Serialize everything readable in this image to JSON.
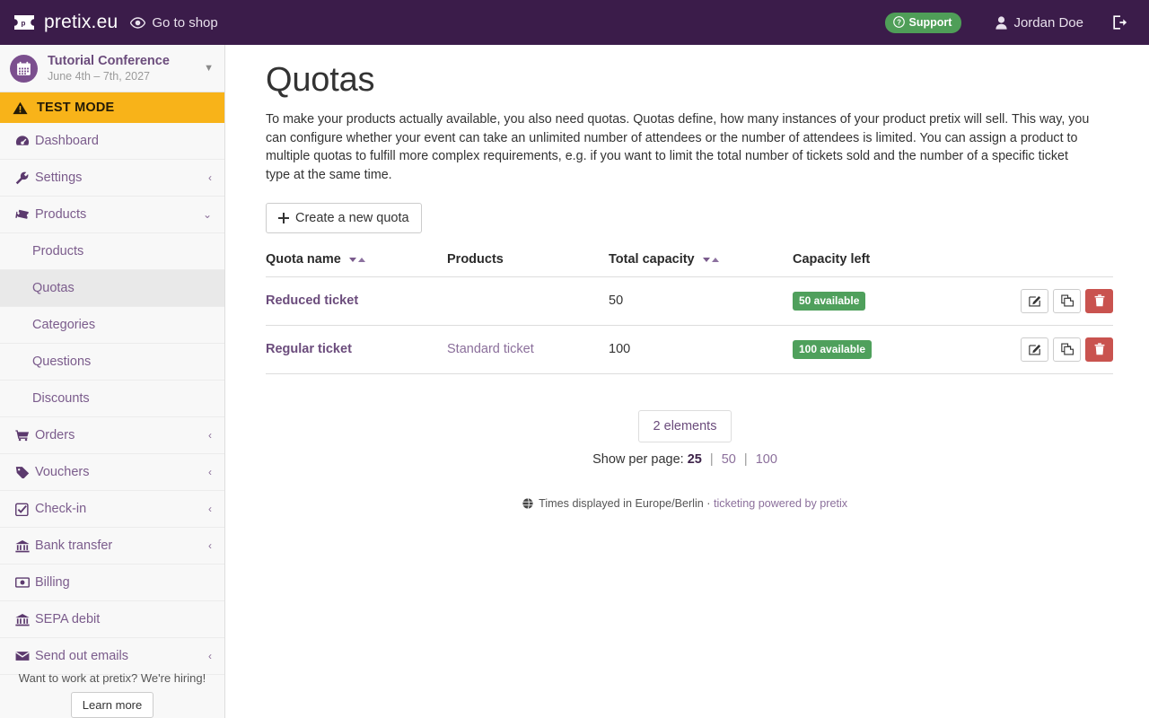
{
  "navbar": {
    "brand": "pretix.eu",
    "brand_logo_icon": "pretix-ticket-logo-icon",
    "shop_link": "Go to shop",
    "shop_icon": "eye-icon",
    "support_label": "Support",
    "support_icon": "question-circle-icon",
    "user_name": "Jordan Doe",
    "user_icon": "user-icon",
    "logout_icon": "sign-out-icon"
  },
  "sidebar": {
    "event": {
      "name": "Tutorial Conference",
      "dates": "June 4th – 7th, 2027",
      "avatar_icon": "calendar-icon",
      "caret_icon": "chevron-down-icon"
    },
    "test_mode": {
      "label": "TEST MODE",
      "icon": "warning-triangle-icon",
      "background": "#f8b319"
    },
    "items": [
      {
        "label": "Dashboard",
        "icon": "tachometer-icon",
        "arrow": "",
        "sub": false,
        "active": false
      },
      {
        "label": "Settings",
        "icon": "wrench-icon",
        "arrow": "‹",
        "sub": false,
        "active": false
      },
      {
        "label": "Products",
        "icon": "tickets-icon",
        "arrow": "⌄",
        "sub": false,
        "active": false
      },
      {
        "label": "Products",
        "icon": "",
        "arrow": "",
        "sub": true,
        "active": false
      },
      {
        "label": "Quotas",
        "icon": "",
        "arrow": "",
        "sub": true,
        "active": true
      },
      {
        "label": "Categories",
        "icon": "",
        "arrow": "",
        "sub": true,
        "active": false
      },
      {
        "label": "Questions",
        "icon": "",
        "arrow": "",
        "sub": true,
        "active": false
      },
      {
        "label": "Discounts",
        "icon": "",
        "arrow": "",
        "sub": true,
        "active": false
      },
      {
        "label": "Orders",
        "icon": "shopping-cart-icon",
        "arrow": "‹",
        "sub": false,
        "active": false
      },
      {
        "label": "Vouchers",
        "icon": "tag-icon",
        "arrow": "‹",
        "sub": false,
        "active": false
      },
      {
        "label": "Check-in",
        "icon": "check-square-icon",
        "arrow": "‹",
        "sub": false,
        "active": false
      },
      {
        "label": "Bank transfer",
        "icon": "bank-icon",
        "arrow": "‹",
        "sub": false,
        "active": false
      },
      {
        "label": "Billing",
        "icon": "money-bill-icon",
        "arrow": "",
        "sub": false,
        "active": false
      },
      {
        "label": "SEPA debit",
        "icon": "bank-icon",
        "arrow": "",
        "sub": false,
        "active": false
      },
      {
        "label": "Send out emails",
        "icon": "envelope-icon",
        "arrow": "‹",
        "sub": false,
        "active": false
      }
    ],
    "hiring": {
      "text": "Want to work at pretix? We're hiring!",
      "button": "Learn more"
    }
  },
  "main": {
    "title": "Quotas",
    "description": "To make your products actually available, you also need quotas. Quotas define, how many instances of your product pretix will sell. This way, you can configure whether your event can take an unlimited number of attendees or the number of attendees is limited. You can assign a product to multiple quotas to fulfill more complex requirements, e.g. if you want to limit the total number of tickets sold and the number of a specific ticket type at the same time.",
    "create_button": {
      "label": "Create a new quota",
      "icon": "plus-icon"
    },
    "table": {
      "headers": [
        {
          "label": "Quota name",
          "sortable": true
        },
        {
          "label": "Products",
          "sortable": false
        },
        {
          "label": "Total capacity",
          "sortable": true
        },
        {
          "label": "Capacity left",
          "sortable": false
        },
        {
          "label": "",
          "sortable": false
        }
      ],
      "rows": [
        {
          "quota_name": "Reduced ticket",
          "products": "",
          "total_capacity": "50",
          "capacity_left": "50 available",
          "actions": [
            {
              "name": "edit-button",
              "icon": "pencil-square-icon"
            },
            {
              "name": "clone-button",
              "icon": "copy-icon"
            },
            {
              "name": "delete-button",
              "icon": "trash-icon"
            }
          ]
        },
        {
          "quota_name": "Regular ticket",
          "products": "Standard ticket",
          "total_capacity": "100",
          "capacity_left": "100 available",
          "actions": [
            {
              "name": "edit-button",
              "icon": "pencil-square-icon"
            },
            {
              "name": "clone-button",
              "icon": "copy-icon"
            },
            {
              "name": "delete-button",
              "icon": "trash-icon"
            }
          ]
        }
      ]
    },
    "pager": {
      "count_label": "2 elements",
      "per_page_label": "Show per page:",
      "options": [
        {
          "label": "25",
          "selected": true
        },
        {
          "label": "50",
          "selected": false
        },
        {
          "label": "100",
          "selected": false
        }
      ],
      "separator": "|"
    },
    "footer": {
      "icon": "globe-icon",
      "timezone_text": "Times displayed in Europe/Berlin",
      "separator": " · ",
      "powered_by": "ticketing powered by pretix"
    }
  },
  "colors": {
    "navbar_bg": "#3b1c4a",
    "brand_purple": "#6b4c7c",
    "test_mode_amber": "#f8b319",
    "badge_green": "#4fa05c",
    "danger_red": "#c9534f",
    "support_green": "#4f9e58"
  }
}
